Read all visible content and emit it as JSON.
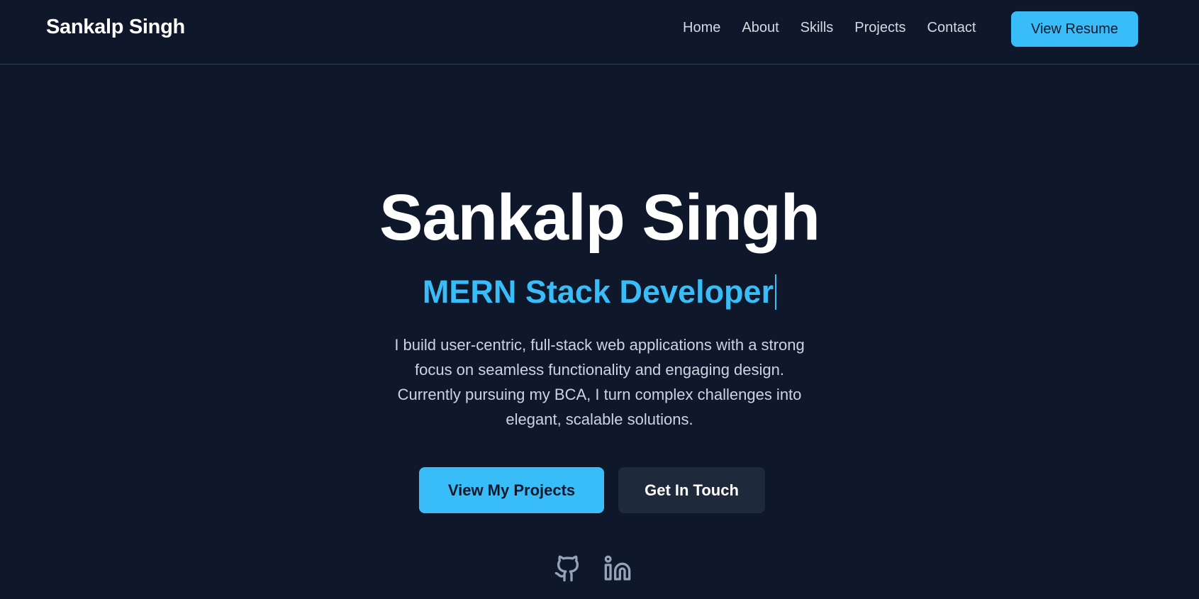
{
  "nav": {
    "brand": "Sankalp Singh",
    "links": [
      {
        "label": "Home"
      },
      {
        "label": "About"
      },
      {
        "label": "Skills"
      },
      {
        "label": "Projects"
      },
      {
        "label": "Contact"
      }
    ],
    "resume_button": "View Resume"
  },
  "hero": {
    "name": "Sankalp Singh",
    "role": "MERN Stack Developer",
    "description": "I build user-centric, full-stack web applications with a strong focus on seamless functionality and engaging design. Currently pursuing my BCA, I turn complex challenges into elegant, scalable solutions.",
    "primary_button": "View My Projects",
    "secondary_button": "Get In Touch"
  },
  "socials": [
    {
      "icon": "github-icon"
    },
    {
      "icon": "linkedin-icon"
    }
  ],
  "colors": {
    "background": "#0f172a",
    "accent": "#38bdf8",
    "secondary_button": "#1e293b",
    "muted_text": "#cbd5e1",
    "icon": "#94a3b8"
  }
}
